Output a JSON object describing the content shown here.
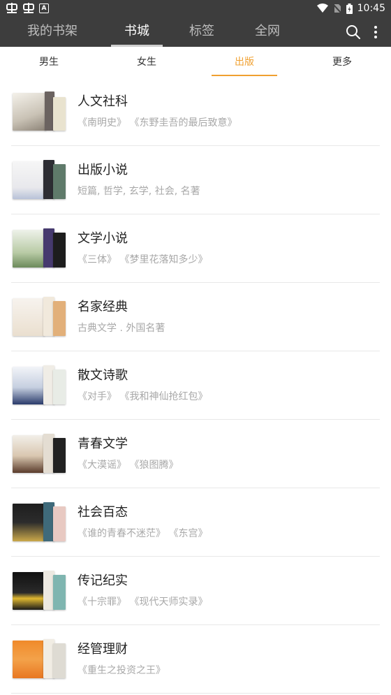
{
  "status_bar": {
    "time": "10:45"
  },
  "top_tabs": [
    "我的书架",
    "书城",
    "标签",
    "全网"
  ],
  "sub_tabs": [
    "男生",
    "女生",
    "出版",
    "更多"
  ],
  "categories": [
    {
      "title": "人文社科",
      "subtitle": "《南明史》 《东野圭吾的最后致意》"
    },
    {
      "title": "出版小说",
      "subtitle": "短篇, 哲学, 玄学, 社会, 名著"
    },
    {
      "title": "文学小说",
      "subtitle": "《三体》 《梦里花落知多少》"
    },
    {
      "title": "名家经典",
      "subtitle": "古典文学 . 外国名著"
    },
    {
      "title": "散文诗歌",
      "subtitle": "《对手》 《我和神仙抢红包》"
    },
    {
      "title": "青春文学",
      "subtitle": "《大漠谣》 《狼图腾》"
    },
    {
      "title": "社会百态",
      "subtitle": "《谁的青春不迷茫》 《东宫》"
    },
    {
      "title": "传记纪实",
      "subtitle": "《十宗罪》 《现代天师实录》"
    },
    {
      "title": "经管理财",
      "subtitle": "《重生之投资之王》"
    }
  ],
  "colors": {
    "header_bg": "#3d3d3d",
    "accent": "#f0a030"
  },
  "icons": {
    "status_left": [
      "app-icon",
      "app-icon",
      "a-badge-icon"
    ],
    "status_right": [
      "wifi-icon",
      "no-sim-icon",
      "battery-icon"
    ],
    "appbar": [
      "search-icon",
      "more-vert-icon"
    ]
  }
}
